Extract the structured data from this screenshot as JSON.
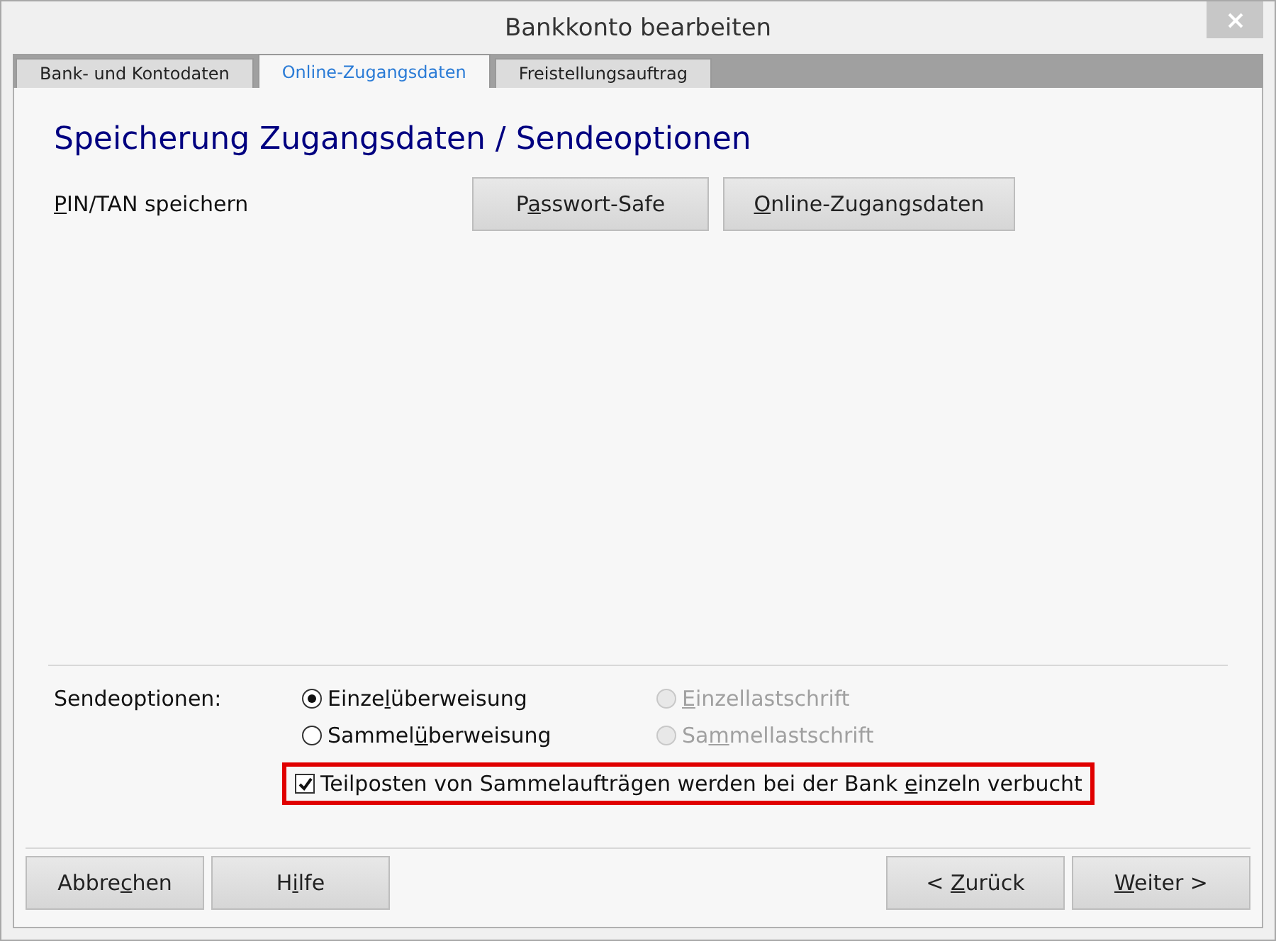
{
  "window": {
    "title": "Bankkonto bearbeiten"
  },
  "tabs": [
    {
      "label": "Bank- und Kontodaten",
      "selected": false
    },
    {
      "label": "Online-Zugangsdaten",
      "selected": true
    },
    {
      "label": "Freistellungsauftrag",
      "selected": false
    }
  ],
  "heading": "Speicherung Zugangsdaten / Sendeoptionen",
  "pin_row": {
    "label": {
      "key": "P",
      "post": "IN/TAN speichern"
    },
    "buttons": [
      {
        "pre": "P",
        "key": "a",
        "post": "sswort-Safe"
      },
      {
        "key": "O",
        "post": "nline-Zugangsdaten"
      }
    ]
  },
  "send_options": {
    "label": "Sendeoptionen:",
    "radios": [
      {
        "label": {
          "pre": "Einze",
          "key": "l",
          "post": "überweisung"
        },
        "selected": true,
        "disabled": false
      },
      {
        "label": {
          "key": "E",
          "post": "inzellastschrift"
        },
        "selected": false,
        "disabled": true
      },
      {
        "label": {
          "pre": "Sammel",
          "key": "ü",
          "post": "berweisung"
        },
        "selected": false,
        "disabled": false
      },
      {
        "label": {
          "pre": "Sa",
          "key": "m",
          "post": "mellastschrift"
        },
        "selected": false,
        "disabled": true
      }
    ],
    "checkbox": {
      "label": {
        "pre": "Teilposten von Sammelaufträgen werden bei der Bank ",
        "key": "e",
        "post": "inzeln verbucht"
      },
      "checked": true,
      "highlighted": true
    }
  },
  "buttons_left": [
    {
      "pre": "Abbre",
      "key": "c",
      "post": "hen"
    },
    {
      "pre": "H",
      "key": "i",
      "post": "lfe"
    }
  ],
  "buttons_right": [
    {
      "pre": "< ",
      "key": "Z",
      "post": "urück"
    },
    {
      "key": "W",
      "post": "eiter >"
    }
  ]
}
